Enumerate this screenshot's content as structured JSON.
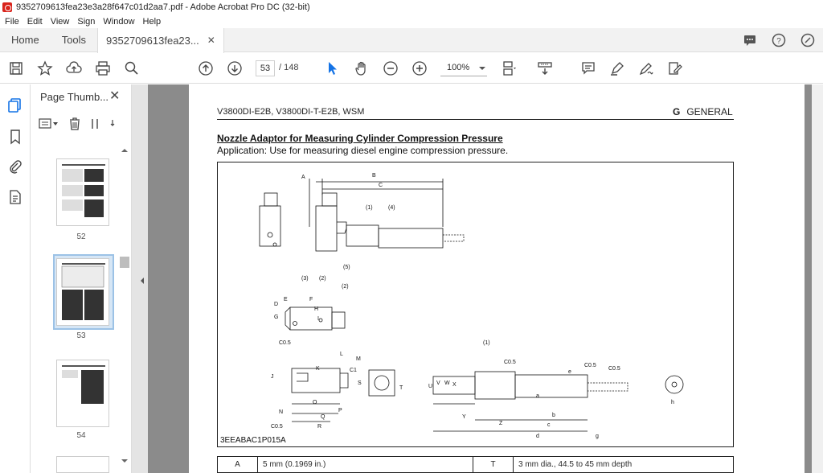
{
  "window": {
    "title": "9352709613fea23e3a28f647c01d2aa7.pdf - Adobe Acrobat Pro DC (32-bit)"
  },
  "menu": [
    "File",
    "Edit",
    "View",
    "Sign",
    "Window",
    "Help"
  ],
  "tabs": {
    "home": "Home",
    "tools": "Tools",
    "doc": "9352709613fea23..."
  },
  "toolbar": {
    "current_page": "53",
    "total_pages": "/ 148",
    "zoom": "100%"
  },
  "panel": {
    "title": "Page Thumb..."
  },
  "thumbnails": [
    {
      "label": "52"
    },
    {
      "label": "53",
      "selected": true
    },
    {
      "label": "54"
    }
  ],
  "document": {
    "header_left": "V3800DI-E2B, V3800DI-T-E2B, WSM",
    "header_section_letter": "G",
    "header_section": "GENERAL",
    "title": "Nozzle Adaptor for Measuring Cylinder Compression Pressure",
    "application": "Application:  Use for measuring diesel engine compression pressure.",
    "figure_code": "3EEABAC1P015A",
    "figure_labels": {
      "A": "A",
      "B": "B",
      "C": "C",
      "D": "D",
      "E": "E",
      "F": "F",
      "G": "G",
      "H": "H",
      "I": "I",
      "J": "J",
      "K": "K",
      "L": "L",
      "M": "M",
      "N": "N",
      "O": "O",
      "P": "P",
      "Q": "Q",
      "R": "R",
      "S": "S",
      "T": "T",
      "U": "U",
      "V": "V",
      "W": "W",
      "X": "X",
      "Y": "Y",
      "Z": "Z",
      "a": "a",
      "b": "b",
      "c": "c",
      "d": "d",
      "e": "e",
      "g": "g",
      "h": "h",
      "p1": "(1)",
      "p2": "(2)",
      "p3": "(3)",
      "p4": "(4)",
      "p5": "(5)",
      "C05": "C0.5",
      "C1": "C1",
      "dotS": "S"
    },
    "spec_row": {
      "key_left": "A",
      "value_left": "5 mm (0.1969 in.)",
      "key_right": "T",
      "value_right": "3 mm dia., 44.5 to 45 mm depth"
    }
  },
  "colors": {
    "accent_blue": "#1473e6",
    "pdf_red": "#d9241c",
    "viewer_bg": "#8b8b8b"
  }
}
